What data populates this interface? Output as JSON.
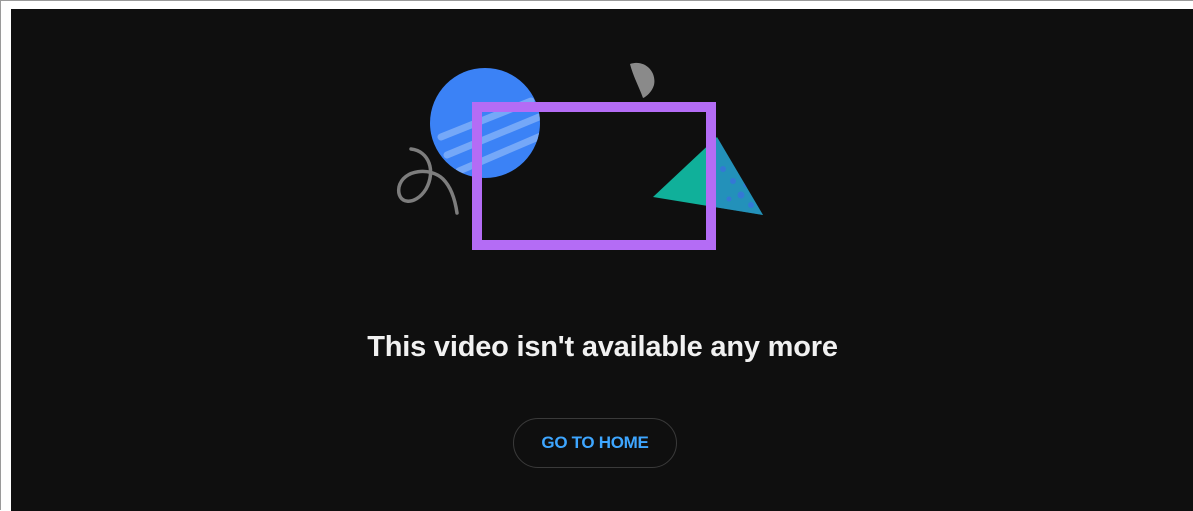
{
  "unavailable": {
    "message": "This video isn't available any more",
    "button_label": "GO TO HOME"
  },
  "colors": {
    "background": "#0f0f0f",
    "message_text": "#f1f1f1",
    "button_text": "#3ea6ff",
    "button_border": "#3a3a3a",
    "circle": "#3b82f6",
    "frame": "#b46cf5",
    "triangle": "#10b09a",
    "squiggle": "#808080"
  },
  "illustration": {
    "icons": [
      "blue-circle-icon",
      "purple-frame-icon",
      "green-triangle-icon",
      "gray-squiggle-icon",
      "gray-leaf-icon"
    ]
  }
}
